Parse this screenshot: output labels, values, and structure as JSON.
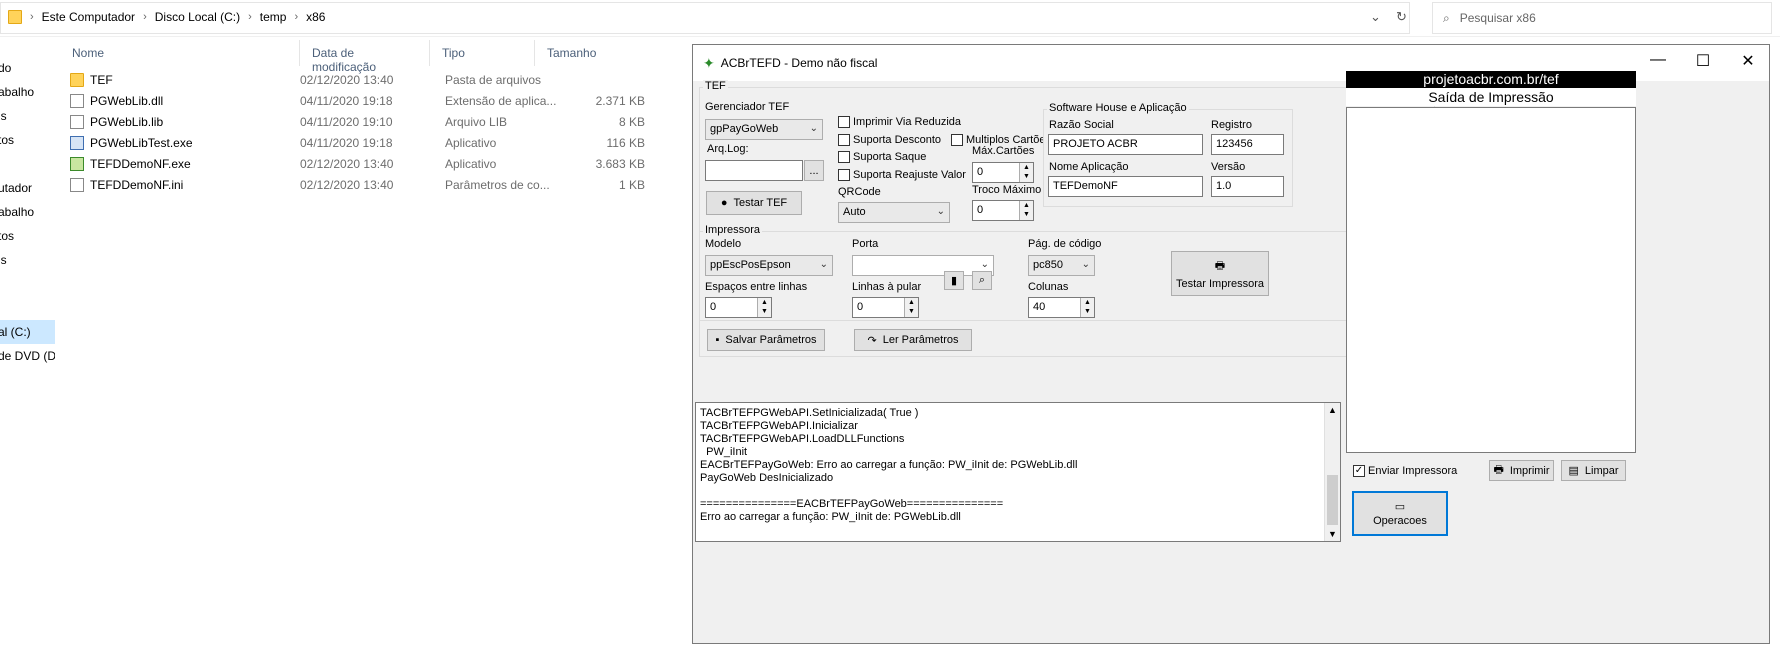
{
  "explorer": {
    "breadcrumb": [
      "Este Computador",
      "Disco Local (C:)",
      "temp",
      "x86"
    ],
    "search_placeholder": "Pesquisar x86",
    "nav_items": [
      "do",
      "abalho",
      "ls",
      "tos",
      "",
      "utador",
      "abalho",
      "tos",
      "ls",
      "",
      "",
      "",
      "al (C:)",
      "de DVD (D:"
    ],
    "columns": {
      "name": "Nome",
      "date": "Data de modificação",
      "type": "Tipo",
      "size": "Tamanho"
    },
    "files": [
      {
        "name": "TEF",
        "date": "02/12/2020 13:40",
        "type": "Pasta de arquivos",
        "size": "",
        "icon": "folder-icon"
      },
      {
        "name": "PGWebLib.dll",
        "date": "04/11/2020 19:18",
        "type": "Extensão de aplica...",
        "size": "2.371 KB",
        "icon": "dll-file-icon"
      },
      {
        "name": "PGWebLib.lib",
        "date": "04/11/2020 19:10",
        "type": "Arquivo LIB",
        "size": "8 KB",
        "icon": "file-icon"
      },
      {
        "name": "PGWebLibTest.exe",
        "date": "04/11/2020 19:18",
        "type": "Aplicativo",
        "size": "116 KB",
        "icon": "exe-file-icon"
      },
      {
        "name": "TEFDDemoNF.exe",
        "date": "02/12/2020 13:40",
        "type": "Aplicativo",
        "size": "3.683 KB",
        "icon": "exe-file-icon"
      },
      {
        "name": "TEFDDemoNF.ini",
        "date": "02/12/2020 13:40",
        "type": "Parâmetros de co...",
        "size": "1 KB",
        "icon": "ini-file-icon"
      }
    ]
  },
  "app": {
    "title": "ACBrTEFD - Demo não fiscal",
    "tef": {
      "group": "TEF",
      "gerenciador_label": "Gerenciador TEF",
      "gerenciador_value": "gpPayGoWeb",
      "arqlog_label": "Arq.Log:",
      "arqlog_value": "",
      "browse_label": "...",
      "testar_label": "Testar TEF",
      "chk_via_reduzida": "Imprimir Via Reduzida",
      "chk_desconto": "Suporta Desconto",
      "chk_saque": "Suporta Saque",
      "chk_reajuste": "Suporta Reajuste Valor",
      "chk_multiplos": "Multiplos Cartões",
      "qrcode_label": "QRCode",
      "qrcode_value": "Auto",
      "max_cartoes_label": "Máx.Cartões",
      "max_cartoes_value": "0",
      "troco_label": "Troco Máximo",
      "troco_value": "0"
    },
    "software_house": {
      "group": "Software House e Aplicação",
      "razao_label": "Razão Social",
      "razao_value": "PROJETO ACBR",
      "registro_label": "Registro",
      "registro_value": "123456",
      "nome_app_label": "Nome Aplicação",
      "nome_app_value": "TEFDemoNF",
      "versao_label": "Versão",
      "versao_value": "1.0"
    },
    "impressora": {
      "group": "Impressora",
      "modelo_label": "Modelo",
      "modelo_value": "ppEscPosEpson",
      "porta_label": "Porta",
      "porta_value": "",
      "pag_label": "Pág. de código",
      "pag_value": "pc850",
      "espacos_label": "Espaços entre linhas",
      "espacos_value": "0",
      "linhas_label": "Linhas à pular",
      "linhas_value": "0",
      "colunas_label": "Colunas",
      "colunas_value": "40",
      "testar_label": "Testar Impressora"
    },
    "salvar_label": "Salvar Parâmetros",
    "ler_label": "Ler Parâmetros",
    "log": "TACBrTEFPGWebAPI.SetInicializada( True )\nTACBrTEFPGWebAPI.Inicializar\nTACBrTEFPGWebAPI.LoadDLLFunctions\n  PW_iInit\nEACBrTEFPayGoWeb: Erro ao carregar a função: PW_iInit de: PGWebLib.dll\nPayGoWeb DesInicializado\n\n===============EACBrTEFPayGoWeb===============\nErro ao carregar a função: PW_iInit de: PGWebLib.dll",
    "right_panel": {
      "banner": "projetoacbr.com.br/tef",
      "saida_title": "Saída de Impressão",
      "enviar_label": "Enviar Impressora",
      "imprimir_label": "Imprimir",
      "limpar_label": "Limpar",
      "operacoes_label": "Operacoes"
    }
  }
}
